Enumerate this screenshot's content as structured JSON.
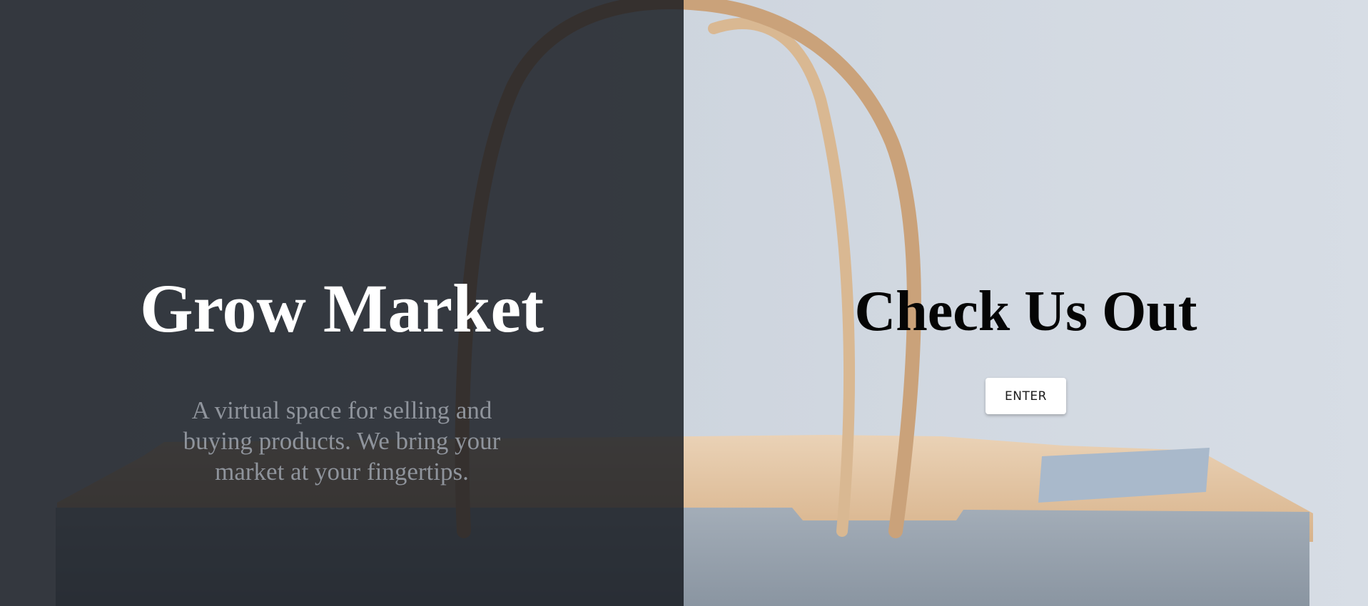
{
  "left_panel": {
    "title": "Grow Market",
    "tagline": "A virtual space for selling and buying products. We bring your market at your fingertips."
  },
  "right_panel": {
    "title": "Check Us Out",
    "enter_label": "ENTER"
  },
  "colors": {
    "left_overlay": "#14171d",
    "right_background": "#cfd6df",
    "bag_paper": "#e3c3a0",
    "bag_body": "#8f9aa6",
    "title_left": "#ffffff",
    "title_right": "#050505",
    "tagline": "#8f949c",
    "button_background": "#ffffff"
  },
  "background_image": {
    "icon": "paper-shopping-bag-photo"
  }
}
